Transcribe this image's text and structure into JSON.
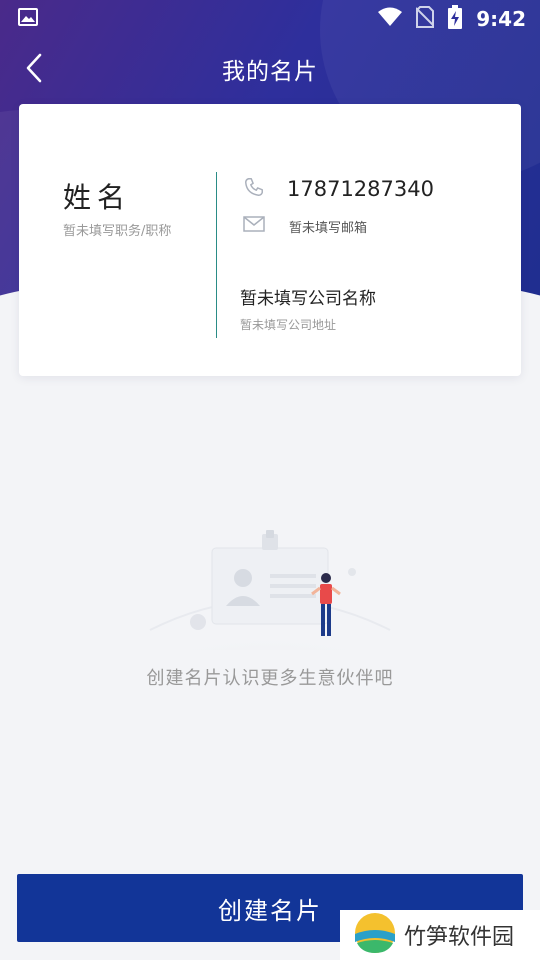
{
  "status_bar": {
    "time": "9:42"
  },
  "header": {
    "title": "我的名片",
    "back_label": ""
  },
  "card": {
    "name": "姓名",
    "role": "暂未填写职务/职称",
    "phone": "17871287340",
    "email": "暂未填写邮箱",
    "company": "暂未填写公司名称",
    "address": "暂未填写公司地址"
  },
  "empty_state": {
    "text": "创建名片认识更多生意伙伴吧"
  },
  "actions": {
    "create_label": "创建名片"
  },
  "watermark": {
    "text": "竹笋软件园"
  },
  "colors": {
    "header_gradient_start": "#4a2a8a",
    "header_gradient_end": "#1f2e8f",
    "primary_button": "#123598",
    "divider": "#2a8c86",
    "background": "#f3f4f7"
  },
  "icons": [
    "image-icon",
    "wifi-icon",
    "no-sim-icon",
    "battery-charging-icon",
    "back-arrow-icon",
    "phone-icon",
    "mail-icon"
  ]
}
